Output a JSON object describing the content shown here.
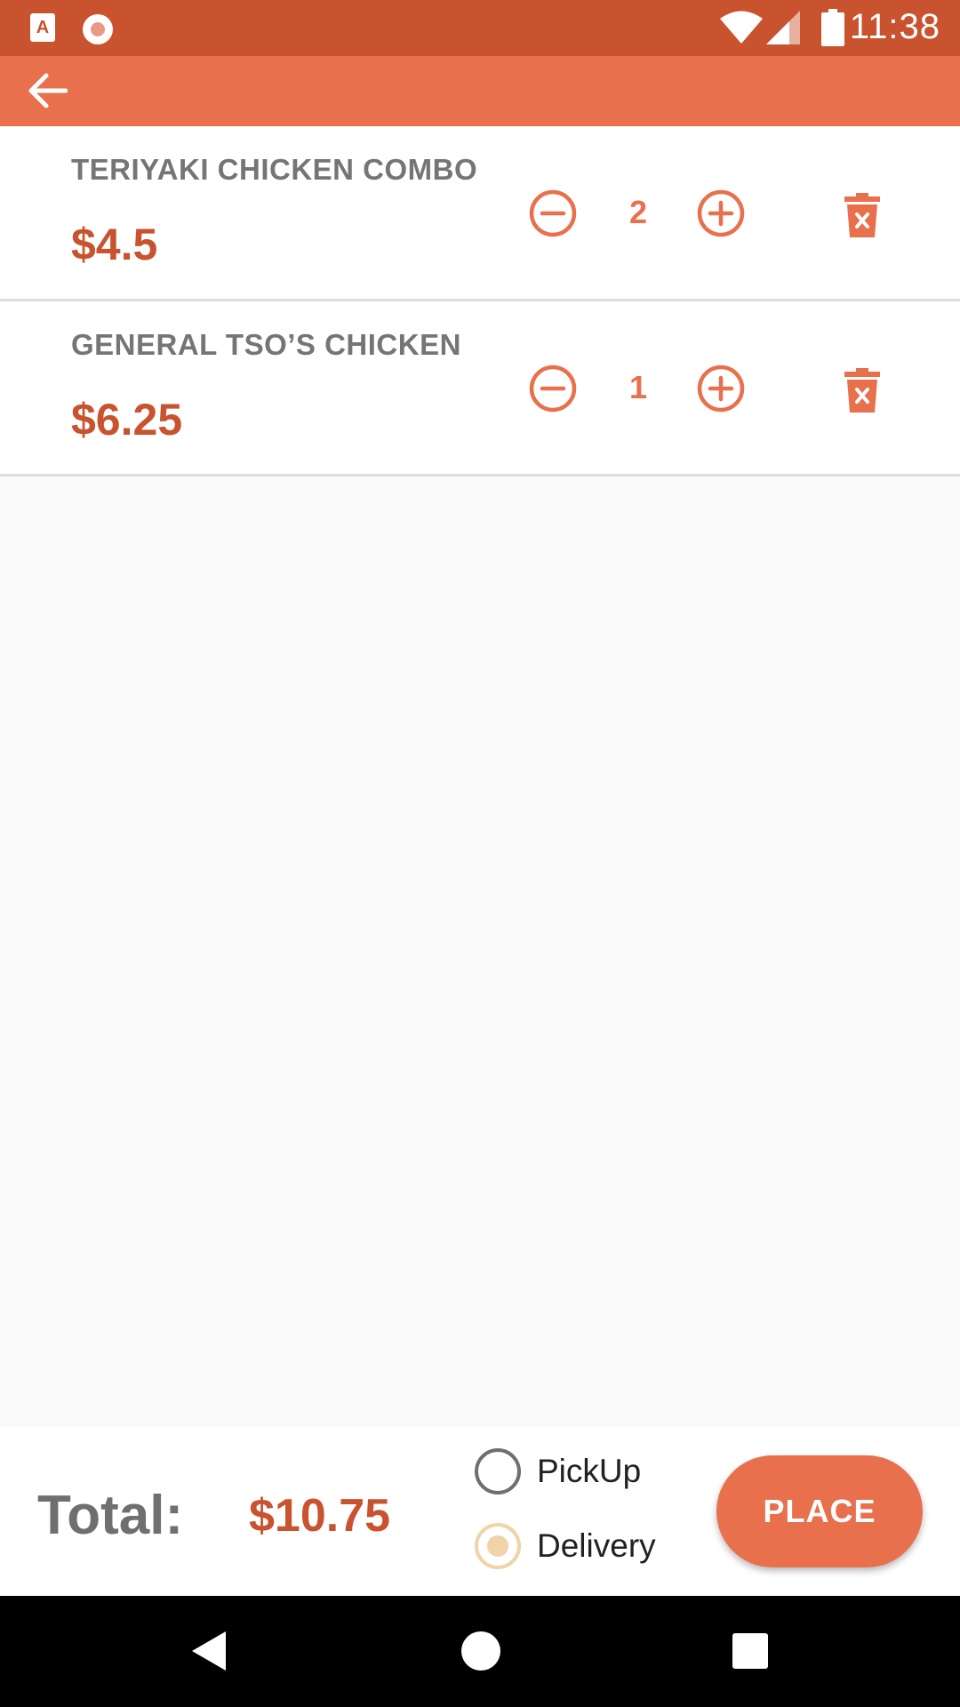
{
  "status_bar": {
    "time": "11:38",
    "bg_color": "#c8532e"
  },
  "app_bar": {
    "bg_color": "#e8704c",
    "back_icon": "arrow-left-icon"
  },
  "cart": {
    "items": [
      {
        "name": "TERIYAKI CHICKEN COMBO",
        "price": "$4.5",
        "quantity": "2"
      },
      {
        "name": "GENERAL TSO’S CHICKEN",
        "price": "$6.25",
        "quantity": "1"
      }
    ],
    "accent_color": "#e8704c",
    "price_color": "#c8532e"
  },
  "footer": {
    "total_label": "Total:",
    "total_value": "$10.75",
    "options": [
      {
        "label": "PickUp",
        "selected": false
      },
      {
        "label": "Delivery",
        "selected": true
      }
    ],
    "place_label": "PLACE"
  }
}
